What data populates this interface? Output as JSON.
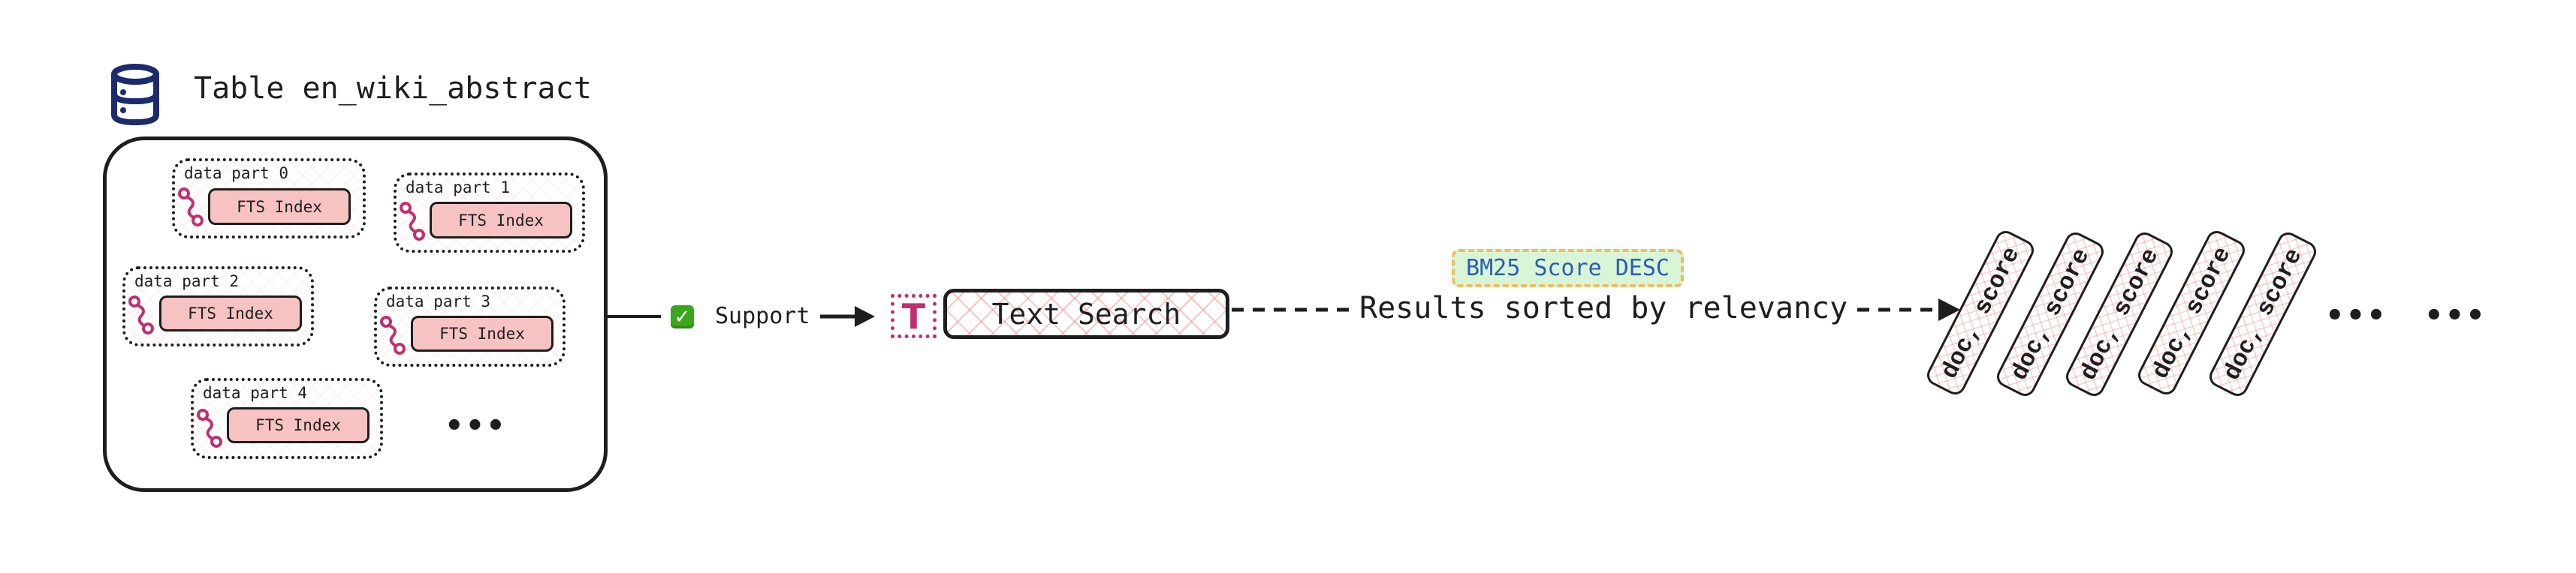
{
  "table": {
    "title": "Table en_wiki_abstract",
    "icon": "database-icon",
    "data_parts": [
      {
        "label": "data part 0",
        "index_label": "FTS Index",
        "icon": "route-icon"
      },
      {
        "label": "data part 1",
        "index_label": "FTS Index",
        "icon": "route-icon"
      },
      {
        "label": "data part 2",
        "index_label": "FTS Index",
        "icon": "route-icon"
      },
      {
        "label": "data part 3",
        "index_label": "FTS Index",
        "icon": "route-icon"
      },
      {
        "label": "data part 4",
        "index_label": "FTS Index",
        "icon": "route-icon"
      }
    ],
    "more": "•••"
  },
  "support": {
    "check_glyph": "✓",
    "label": "Support"
  },
  "text_search": {
    "icon_glyph": "T",
    "label": "Text Search"
  },
  "results": {
    "sort_badge": "BM25 Score DESC",
    "edge_label": "Results sorted by relevancy",
    "cards": [
      {
        "label": "doc, score"
      },
      {
        "label": "doc, score"
      },
      {
        "label": "doc, score"
      },
      {
        "label": "doc, score"
      },
      {
        "label": "doc, score"
      }
    ],
    "more_1": "•••",
    "more_2": "•••"
  },
  "colors": {
    "stroke": "#1e1e1e",
    "index_fill": "#f7c3c2",
    "accent_magenta": "#c0306e",
    "database_icon": "#1c2a6e",
    "badge_fill": "#d8f5d6",
    "badge_border": "#f2bb66",
    "badge_text": "#2a5cb8",
    "check_green": "#3aa61c"
  }
}
